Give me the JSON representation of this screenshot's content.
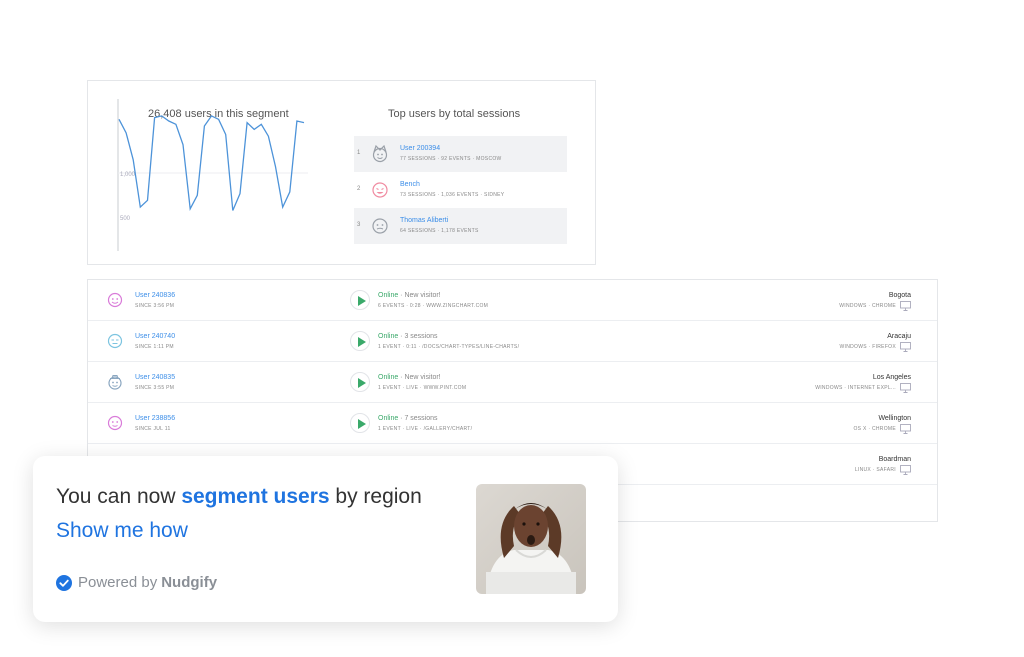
{
  "segment": {
    "title": "26,408 users in this segment"
  },
  "chart_data": {
    "type": "line",
    "title": "",
    "yticks": [
      "1,000",
      "500"
    ],
    "ylim": [
      400,
      1300
    ],
    "values": [
      1180,
      1100,
      940,
      660,
      700,
      1190,
      1200,
      1170,
      1150,
      1030,
      650,
      730,
      1140,
      1200,
      1180,
      1090,
      640,
      740,
      1160,
      1120,
      1150,
      1080,
      900,
      660,
      750,
      1170,
      1160
    ]
  },
  "top_users": {
    "title": "Top users by total sessions",
    "rows": [
      {
        "rank": "1",
        "name": "User 200394",
        "meta": "77 sessions · 92 events · Moscow",
        "face_color": "#9aa0a8"
      },
      {
        "rank": "2",
        "name": "Bench",
        "meta": "73 sessions · 1,036 events · Sidney",
        "face_color": "#f08aa0"
      },
      {
        "rank": "3",
        "name": "Thomas Aliberti",
        "meta": "64 sessions · 1,178 events",
        "face_color": "#9aa0a8"
      }
    ]
  },
  "sessions": [
    {
      "user": "User 240836",
      "since": "Since 3:56 PM",
      "online": "Online",
      "status_rest": " · New visitor!",
      "detail": "6 events · 0:28 · www.zingchart.com",
      "city": "Bogota",
      "os": "Windows · Chrome",
      "face_color": "#d97bd9"
    },
    {
      "user": "User 240740",
      "since": "Since 1:11 PM",
      "online": "Online",
      "status_rest": " · 3 sessions",
      "detail": "1 event · 0:11 · /docs/chart-types/line-charts/",
      "city": "Aracaju",
      "os": "Windows · Firefox",
      "face_color": "#7cc4e0"
    },
    {
      "user": "User 240835",
      "since": "Since 3:55 PM",
      "online": "Online",
      "status_rest": " · New visitor!",
      "detail": "1 event · live · www.pint.com",
      "city": "Los Angeles",
      "os": "Windows · Internet Expl...",
      "face_color": "#8aa6c0"
    },
    {
      "user": "User 238856",
      "since": "Since Jul 11",
      "online": "Online",
      "status_rest": " · 7 sessions",
      "detail": "1 event · live · /gallery/chart/",
      "city": "Wellington",
      "os": "OS X · Chrome",
      "face_color": "#d97bd9"
    },
    {
      "user": "",
      "since": "",
      "online": "",
      "status_rest": "",
      "detail": "",
      "city": "Boardman",
      "os": "Linux · Safari",
      "face_color": "#cccccc"
    }
  ],
  "nudge": {
    "msg_pre": "You can now ",
    "msg_bold": "segment users",
    "msg_post": " by region",
    "link": "Show me how",
    "powered_prefix": "Powered by",
    "powered_brand": "Nudgify",
    "accent": "#1f74e0"
  }
}
